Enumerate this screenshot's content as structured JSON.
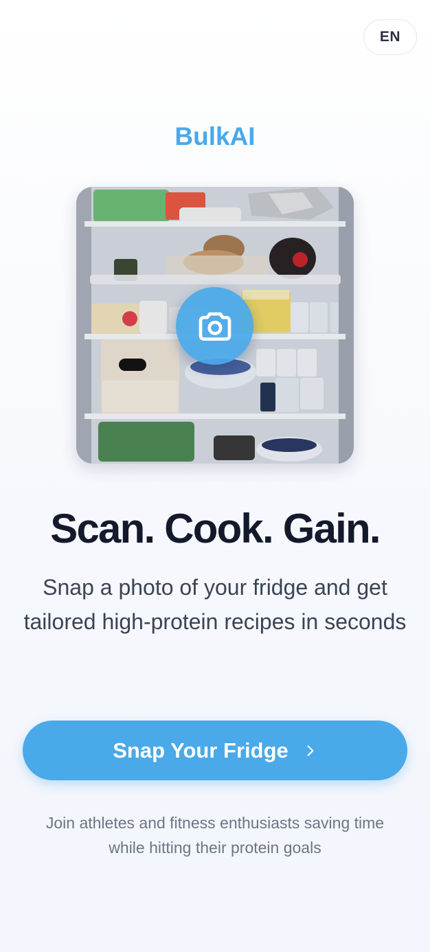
{
  "header": {
    "language_label": "EN"
  },
  "brand": {
    "name": "BulkAI"
  },
  "hero": {
    "image_subject": "open refrigerator with shelves of food",
    "camera_icon": "camera-icon"
  },
  "headline": "Scan. Cook. Gain.",
  "subtitle": "Snap a photo of your fridge and get tailored high-protein recipes in seconds",
  "cta": {
    "label": "Snap Your Fridge",
    "icon": "chevron-right-icon"
  },
  "footer": {
    "text": "Join athletes and fitness enthusiasts saving time while hitting their protein goals"
  },
  "colors": {
    "accent": "#4aa9e8",
    "headline": "#141a2b",
    "body": "#3b4354",
    "muted": "#6c7484"
  }
}
